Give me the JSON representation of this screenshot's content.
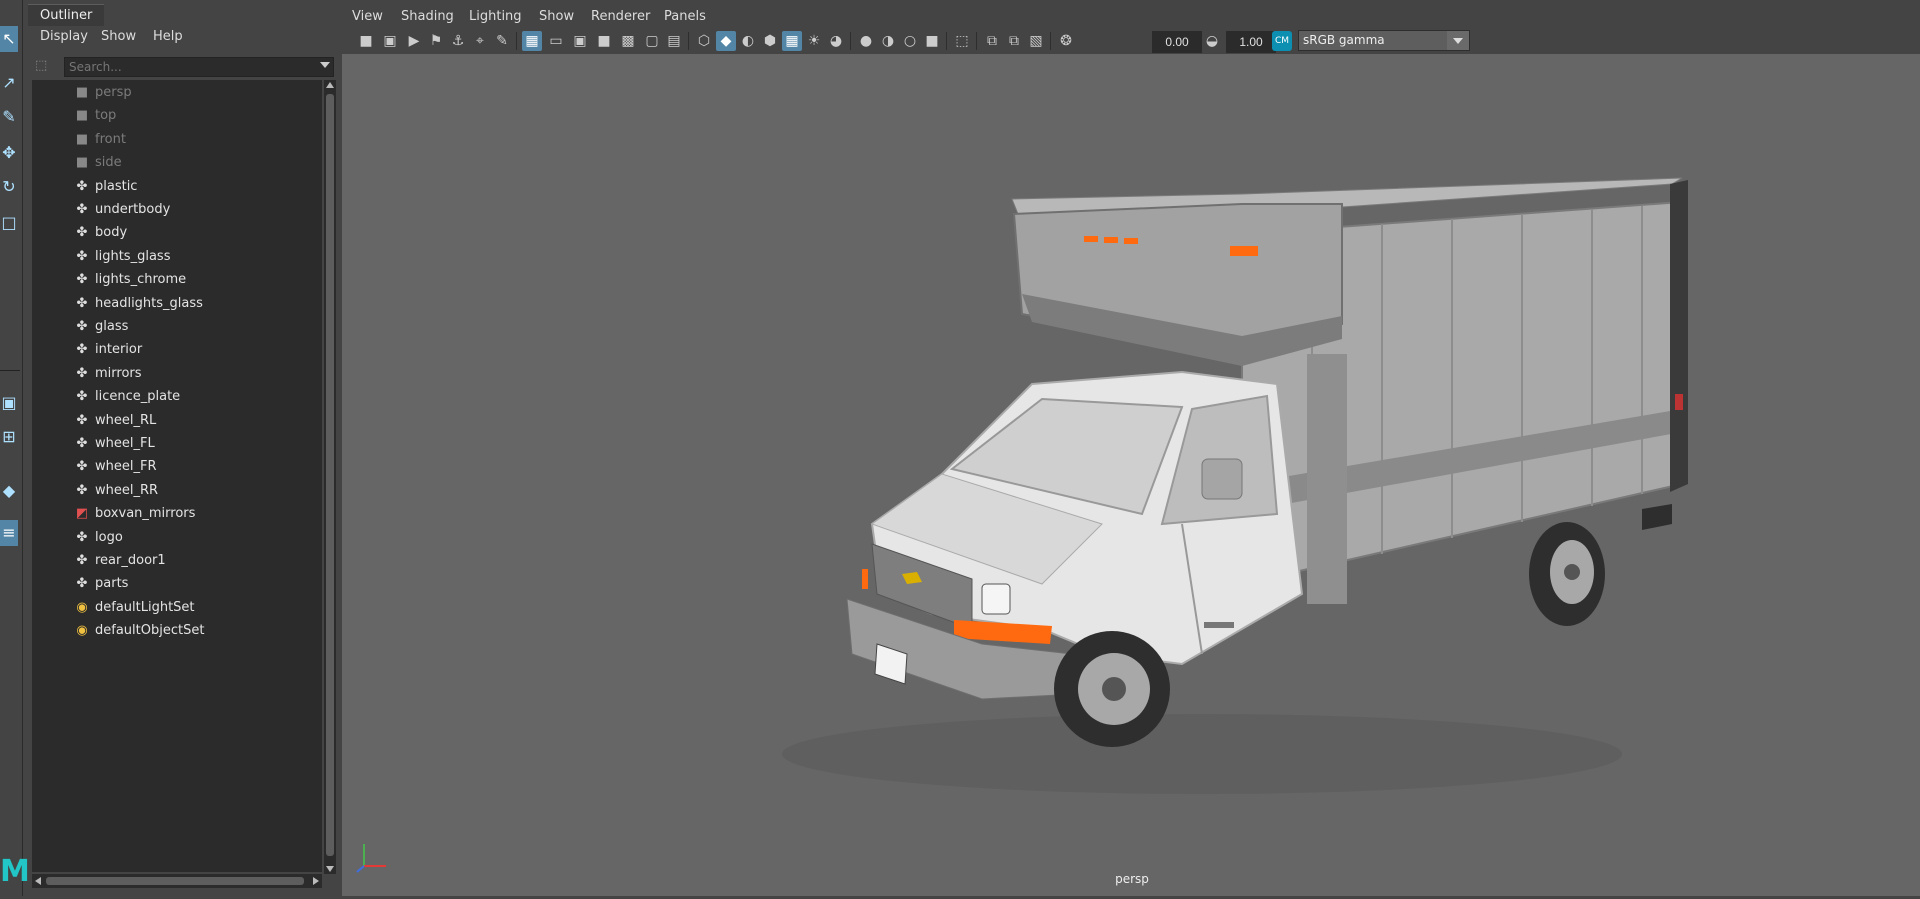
{
  "outliner": {
    "title": "Outliner",
    "menu": [
      "Display",
      "Show",
      "Help"
    ],
    "search_placeholder": "Search...",
    "items": [
      {
        "label": "persp",
        "kind": "camera",
        "icon": "camera-icon"
      },
      {
        "label": "top",
        "kind": "camera",
        "icon": "camera-icon"
      },
      {
        "label": "front",
        "kind": "camera",
        "icon": "camera-icon"
      },
      {
        "label": "side",
        "kind": "camera",
        "icon": "camera-icon"
      },
      {
        "label": "plastic",
        "kind": "group",
        "icon": "group-icon"
      },
      {
        "label": "undertbody",
        "kind": "group",
        "icon": "group-icon"
      },
      {
        "label": "body",
        "kind": "group",
        "icon": "group-icon"
      },
      {
        "label": "lights_glass",
        "kind": "group",
        "icon": "group-icon"
      },
      {
        "label": "lights_chrome",
        "kind": "group",
        "icon": "group-icon"
      },
      {
        "label": "headlights_glass",
        "kind": "group",
        "icon": "group-icon"
      },
      {
        "label": "glass",
        "kind": "group",
        "icon": "group-icon"
      },
      {
        "label": "interior",
        "kind": "group",
        "icon": "group-icon"
      },
      {
        "label": "mirrors",
        "kind": "group",
        "icon": "group-icon"
      },
      {
        "label": "licence_plate",
        "kind": "group",
        "icon": "group-icon"
      },
      {
        "label": "wheel_RL",
        "kind": "group",
        "icon": "group-icon"
      },
      {
        "label": "wheel_FL",
        "kind": "group",
        "icon": "group-icon"
      },
      {
        "label": "wheel_FR",
        "kind": "group",
        "icon": "group-icon"
      },
      {
        "label": "wheel_RR",
        "kind": "group",
        "icon": "group-icon"
      },
      {
        "label": "boxvan_mirrors",
        "kind": "mesh",
        "icon": "mesh-icon"
      },
      {
        "label": "logo",
        "kind": "group",
        "icon": "group-icon"
      },
      {
        "label": "rear_door1",
        "kind": "group",
        "icon": "group-icon"
      },
      {
        "label": "parts",
        "kind": "group",
        "icon": "group-icon"
      },
      {
        "label": "defaultLightSet",
        "kind": "set",
        "icon": "set-icon"
      },
      {
        "label": "defaultObjectSet",
        "kind": "set",
        "icon": "set-icon"
      }
    ]
  },
  "viewport": {
    "menu": [
      "View",
      "Shading",
      "Lighting",
      "Show",
      "Renderer",
      "Panels"
    ],
    "exposure": "0.00",
    "gamma": "1.00",
    "color_space": "sRGB gamma",
    "camera": "persp"
  },
  "colors": {
    "accent": "#5285a6",
    "viewport_bg": "#666666",
    "panel_bg": "#444444",
    "tree_bg": "#2b2b2b",
    "orange_light": "#ff6a10"
  }
}
